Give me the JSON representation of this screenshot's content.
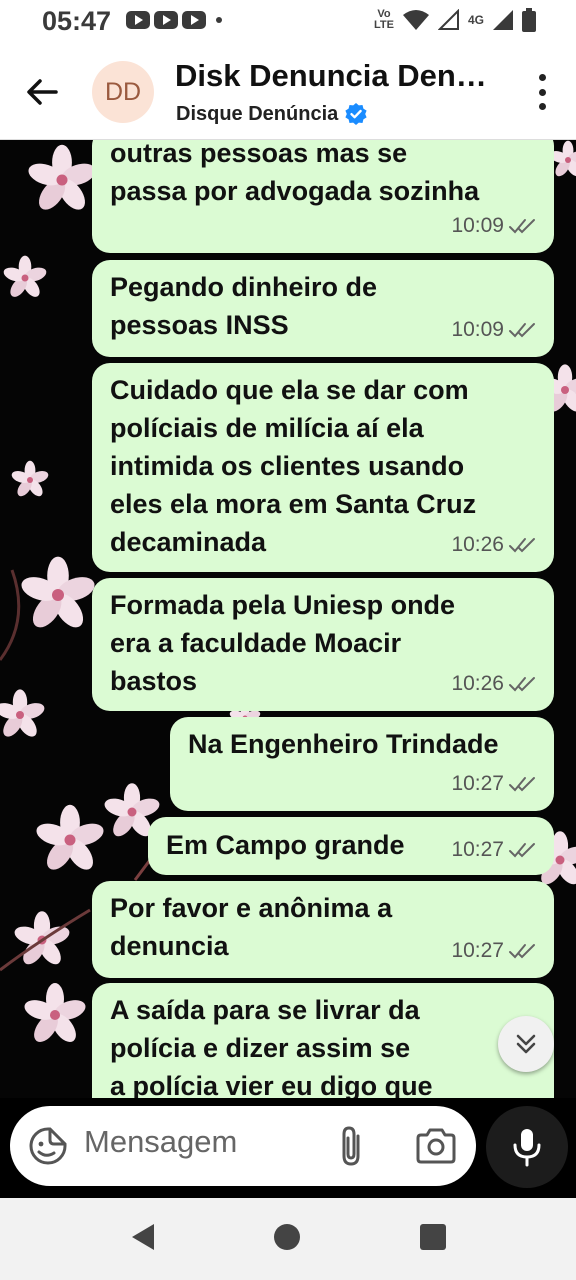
{
  "status_bar": {
    "time": "05:47",
    "volte_top": "Vo",
    "volte_bottom": "LTE",
    "network": "4G"
  },
  "header": {
    "avatar_initials": "DD",
    "title": "Disk Denuncia Den…",
    "subtitle": "Disque Denúncia"
  },
  "messages": [
    {
      "text": "outras pessoas mas se\npassa por advogada sozinha",
      "time": "10:09"
    },
    {
      "text": "Pegando dinheiro de\npessoas INSS",
      "time": "10:09"
    },
    {
      "text": "Cuidado que ela se dar com\npolíciais de milícia aí ela\nintimida os clientes usando\neles ela mora em Santa Cruz\ndecaminada",
      "time": "10:26"
    },
    {
      "text": "Formada pela Uniesp onde\nera a faculdade Moacir\nbastos",
      "time": "10:26"
    },
    {
      "text": "Na Engenheiro Trindade",
      "time": "10:27"
    },
    {
      "text": "Em Campo grande",
      "time": "10:27"
    },
    {
      "text": "Por favor e anônima a\ndenuncia",
      "time": "10:27"
    },
    {
      "text": "A saída para se livrar da\npolícia e dizer assim se\na polícia vier eu digo que",
      "time": ""
    }
  ],
  "composer": {
    "placeholder": "Mensagem"
  },
  "icons": {
    "back": "arrow-left-icon",
    "verified": "verified-badge-icon",
    "menu": "more-vert-icon",
    "read_receipt": "double-check-icon",
    "scroll_down": "double-chevron-down-icon",
    "emoji": "sticker-icon",
    "attach": "paperclip-icon",
    "camera": "camera-icon",
    "mic": "mic-icon"
  },
  "colors": {
    "bubble": "#dbfbd3",
    "verified": "#1a8cff",
    "wallpaper": "#050505"
  }
}
